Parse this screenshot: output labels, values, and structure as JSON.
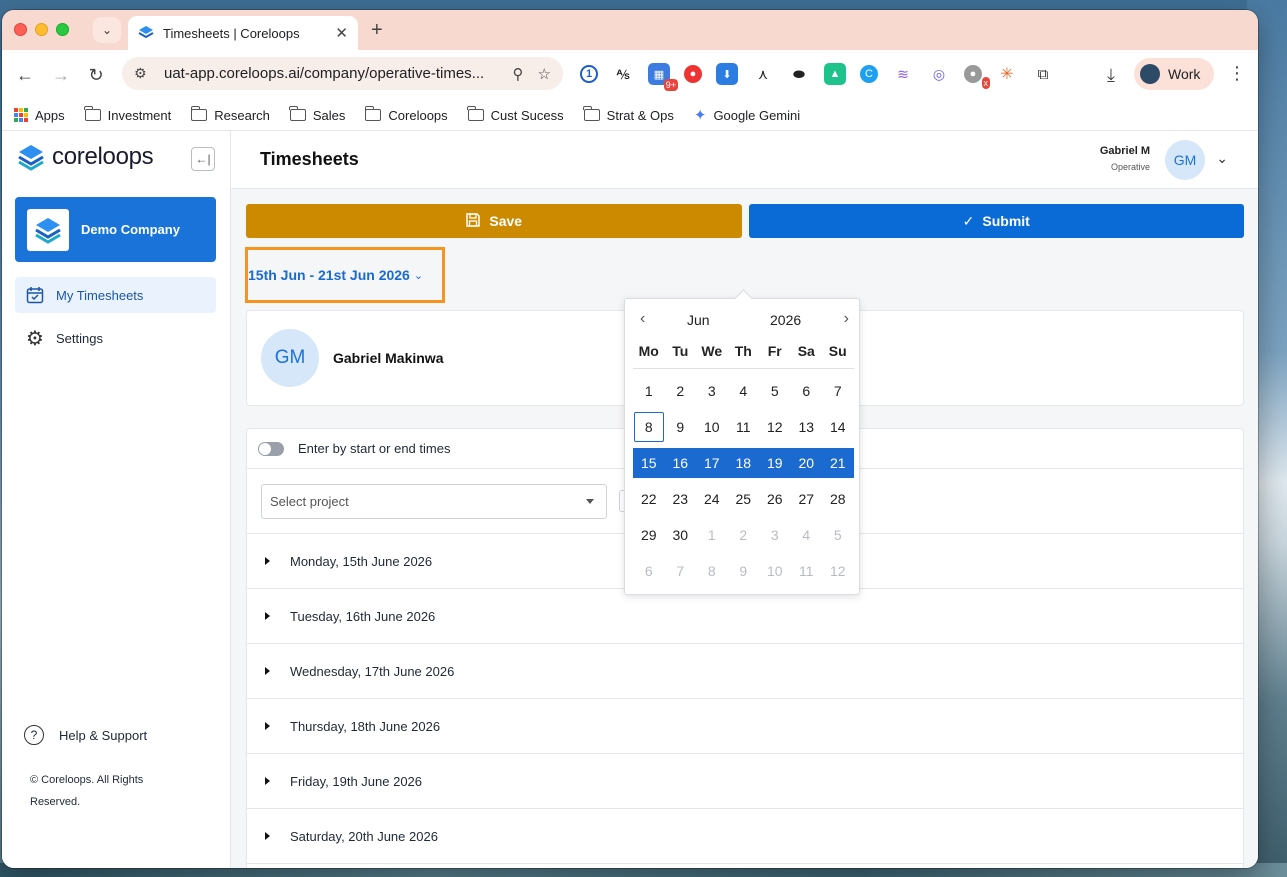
{
  "browser": {
    "tab_title": "Timesheets | Coreloops",
    "url": "uat-app.coreloops.ai/company/operative-times...",
    "profile_label": "Work",
    "ext_badge": "9+",
    "ext_badge2": "x",
    "bookmarks": [
      "Apps",
      "Investment",
      "Research",
      "Sales",
      "Coreloops",
      "Cust Sucess",
      "Strat & Ops",
      "Google Gemini"
    ]
  },
  "sidebar": {
    "logo_text": "coreloops",
    "company_name": "Demo Company",
    "nav": [
      {
        "label": "My Timesheets",
        "icon": "calendar-check-icon"
      },
      {
        "label": "Settings",
        "icon": "gear-icon"
      }
    ],
    "help_label": "Help & Support",
    "copyright": "© Coreloops. All Rights Reserved."
  },
  "header": {
    "title": "Timesheets",
    "user_name": "Gabriel M",
    "user_role": "Operative",
    "user_initials": "GM"
  },
  "actions": {
    "save_label": "Save",
    "submit_label": "Submit",
    "save_color": "#cc8a00",
    "submit_color": "#0b6bd6"
  },
  "date_range": "15th Jun - 21st Jun 2026",
  "profile": {
    "initials": "GM",
    "name": "Gabriel Makinwa"
  },
  "entries": {
    "toggle_label": "Enter by start or end times",
    "project_placeholder": "Select project",
    "days": [
      "Monday, 15th June 2026",
      "Tuesday, 16th June 2026",
      "Wednesday, 17th June 2026",
      "Thursday, 18th June 2026",
      "Friday, 19th June 2026",
      "Saturday, 20th June 2026"
    ]
  },
  "calendar": {
    "month": "Jun",
    "year": "2026",
    "weekdays": [
      "Mo",
      "Tu",
      "We",
      "Th",
      "Fr",
      "Sa",
      "Su"
    ],
    "weeks": [
      [
        {
          "d": "1"
        },
        {
          "d": "2"
        },
        {
          "d": "3"
        },
        {
          "d": "4"
        },
        {
          "d": "5"
        },
        {
          "d": "6"
        },
        {
          "d": "7"
        }
      ],
      [
        {
          "d": "8",
          "today": true
        },
        {
          "d": "9"
        },
        {
          "d": "10"
        },
        {
          "d": "11"
        },
        {
          "d": "12"
        },
        {
          "d": "13"
        },
        {
          "d": "14"
        }
      ],
      [
        {
          "d": "15",
          "sel": true
        },
        {
          "d": "16",
          "sel": true
        },
        {
          "d": "17",
          "sel": true
        },
        {
          "d": "18",
          "sel": true
        },
        {
          "d": "19",
          "sel": true
        },
        {
          "d": "20",
          "sel": true
        },
        {
          "d": "21",
          "sel": true
        }
      ],
      [
        {
          "d": "22"
        },
        {
          "d": "23"
        },
        {
          "d": "24"
        },
        {
          "d": "25"
        },
        {
          "d": "26"
        },
        {
          "d": "27"
        },
        {
          "d": "28"
        }
      ],
      [
        {
          "d": "29"
        },
        {
          "d": "30"
        },
        {
          "d": "1",
          "muted": true
        },
        {
          "d": "2",
          "muted": true
        },
        {
          "d": "3",
          "muted": true
        },
        {
          "d": "4",
          "muted": true
        },
        {
          "d": "5",
          "muted": true
        }
      ],
      [
        {
          "d": "6",
          "muted": true
        },
        {
          "d": "7",
          "muted": true
        },
        {
          "d": "8",
          "muted": true
        },
        {
          "d": "9",
          "muted": true
        },
        {
          "d": "10",
          "muted": true
        },
        {
          "d": "11",
          "muted": true
        },
        {
          "d": "12",
          "muted": true
        }
      ]
    ],
    "selected_color": "#1a6ad0"
  },
  "highlight_color": "#f7941d"
}
